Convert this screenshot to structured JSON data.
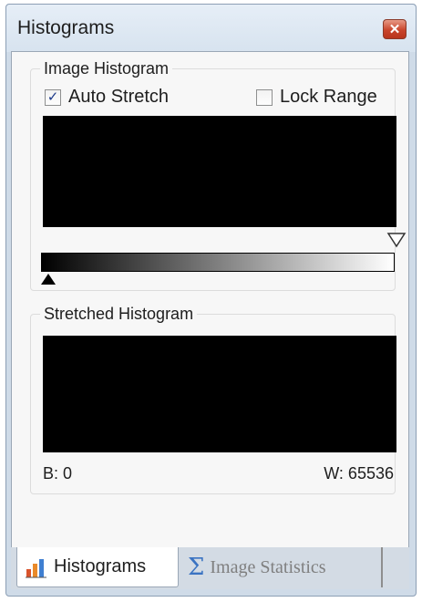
{
  "window": {
    "title": "Histograms"
  },
  "image_histogram": {
    "label": "Image Histogram",
    "auto_stretch": {
      "label": "Auto Stretch",
      "checked": true
    },
    "lock_range": {
      "label": "Lock Range",
      "checked": false
    }
  },
  "stretched_histogram": {
    "label": "Stretched Histogram",
    "black_point": "B: 0",
    "white_point": "W: 65536"
  },
  "tabs": [
    {
      "label": "Histograms",
      "active": true,
      "icon": "bar-chart-icon"
    },
    {
      "label": "Image Statistics",
      "active": false,
      "icon": "sigma-icon"
    }
  ],
  "colors": {
    "window_bg": "#cfdbe8",
    "panel_bg": "#f7f7f7",
    "close_red": "#c9452c"
  }
}
